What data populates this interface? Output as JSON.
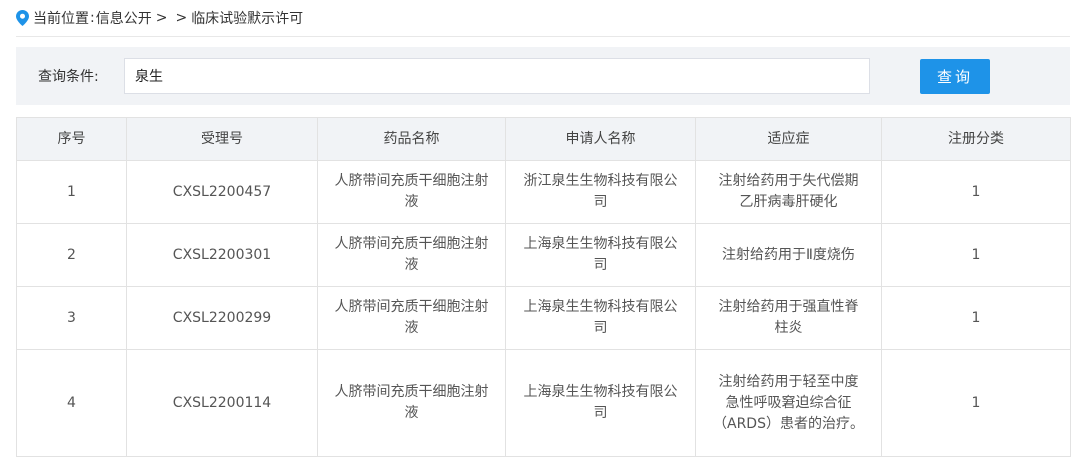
{
  "breadcrumb": {
    "prefix": "当前位置",
    "colon": ":",
    "section": "信息公开",
    "gt1": ">",
    "gt2": ">",
    "current": "临床试验默示许可"
  },
  "search": {
    "label": "查询条件:",
    "value": "泉生",
    "button_label": "查询"
  },
  "table": {
    "headers": [
      "序号",
      "受理号",
      "药品名称",
      "申请人名称",
      "适应症",
      "注册分类"
    ],
    "rows": [
      [
        "1",
        "CXSL2200457",
        "人脐带间充质干细胞注射液",
        "浙江泉生生物科技有限公司",
        "注射给药用于失代偿期乙肝病毒肝硬化",
        "1"
      ],
      [
        "2",
        "CXSL2200301",
        "人脐带间充质干细胞注射液",
        "上海泉生生物科技有限公司",
        "注射给药用于Ⅱ度烧伤",
        "1"
      ],
      [
        "3",
        "CXSL2200299",
        "人脐带间充质干细胞注射液",
        "上海泉生生物科技有限公司",
        "注射给药用于强直性脊柱炎",
        "1"
      ],
      [
        "4",
        "CXSL2200114",
        "人脐带间充质干细胞注射液",
        "上海泉生生物科技有限公司",
        "注射给药用于轻至中度急性呼吸窘迫综合征（ARDS）患者的治疗。",
        "1"
      ]
    ]
  },
  "colors": {
    "accent": "#1e93e8",
    "header_bg": "#f1f3f6",
    "border": "#e2e2e2"
  },
  "icons": {
    "location": "location-pin-icon"
  }
}
